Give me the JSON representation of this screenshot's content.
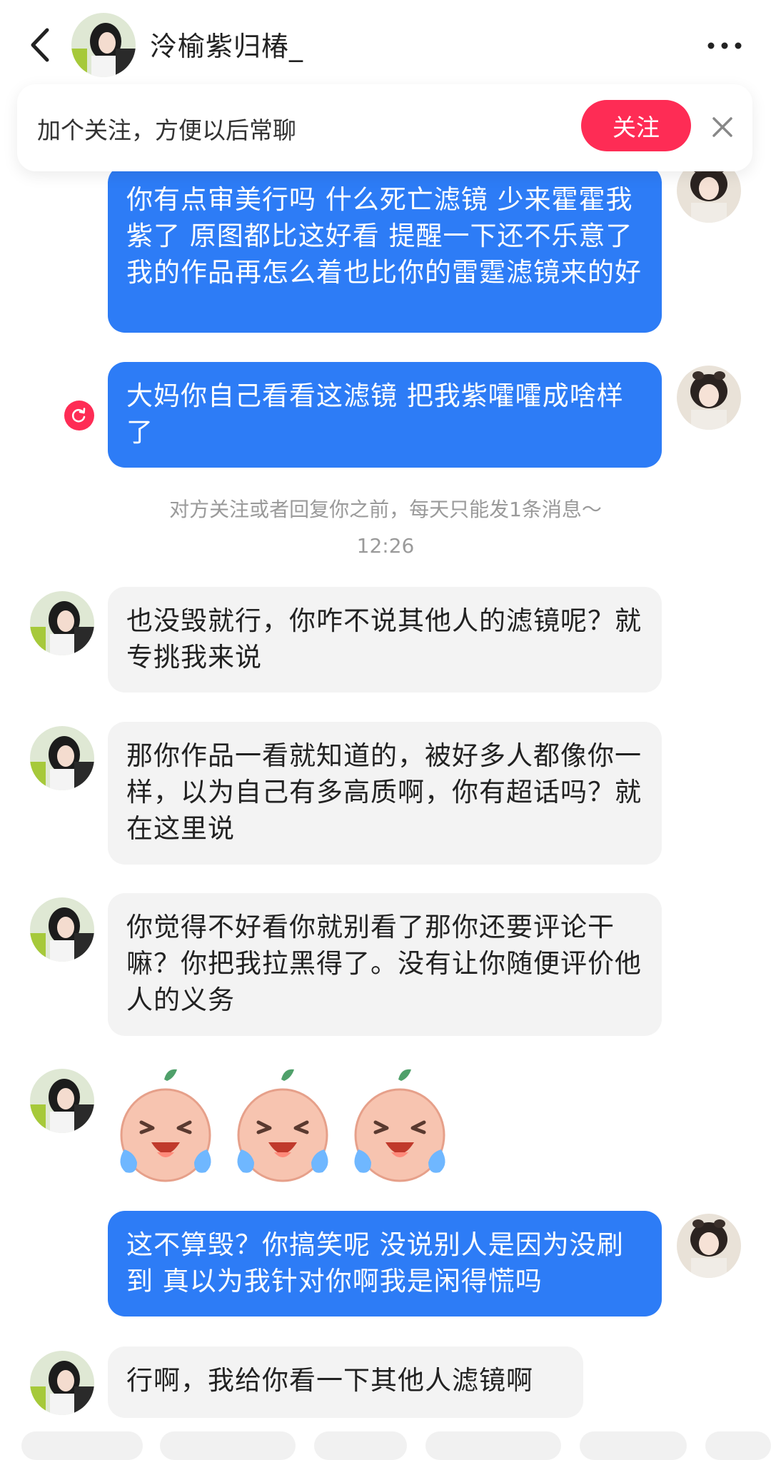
{
  "header": {
    "title": "泠榆紫归椿_",
    "back_icon": "chevron-left-icon",
    "more_icon": "more-dots-icon"
  },
  "banner": {
    "text": "加个关注，方便以后常聊",
    "follow_label": "关注",
    "close_icon": "close-icon",
    "accent": "#fe2c55"
  },
  "messages": [
    {
      "from": "me",
      "text": "你有点审美行吗 什么死亡滤镜 少来霍霍我紫了 原图都比这好看 提醒一下还不乐意了 我的作品再怎么着也比你的雷霆滤镜来的好"
    },
    {
      "from": "me",
      "text": "大妈你自己看看这滤镜 把我紫嚯嚯成啥样了",
      "status": "send-failed"
    },
    {
      "from": "them",
      "text": "也没毁就行，你咋不说其他人的滤镜呢？就专挑我来说"
    },
    {
      "from": "them",
      "text": "那你作品一看就知道的，被好多人都像你一样，以为自己有多高质啊，你有超话吗？就在这里说"
    },
    {
      "from": "them",
      "text": "你觉得不好看你就别看了那你还要评论干嘛？你把我拉黑得了。没有让你随便评价他人的义务"
    },
    {
      "from": "them",
      "type": "stickers",
      "sticker": "crying-laughing-peach",
      "count": 3
    },
    {
      "from": "me",
      "text": "这不算毁？你搞笑呢 没说别人是因为没刷到 真以为我针对你啊我是闲得慌吗"
    },
    {
      "from": "them",
      "text": "行啊，我给你看一下其他人滤镜啊"
    }
  ],
  "system": {
    "notice": "对方关注或者回复你之前，每天只能发1条消息～",
    "time": "12:26"
  },
  "colors": {
    "my_bubble": "#2d7cf6",
    "their_bubble": "#f3f3f3",
    "background": "#ffffff"
  }
}
